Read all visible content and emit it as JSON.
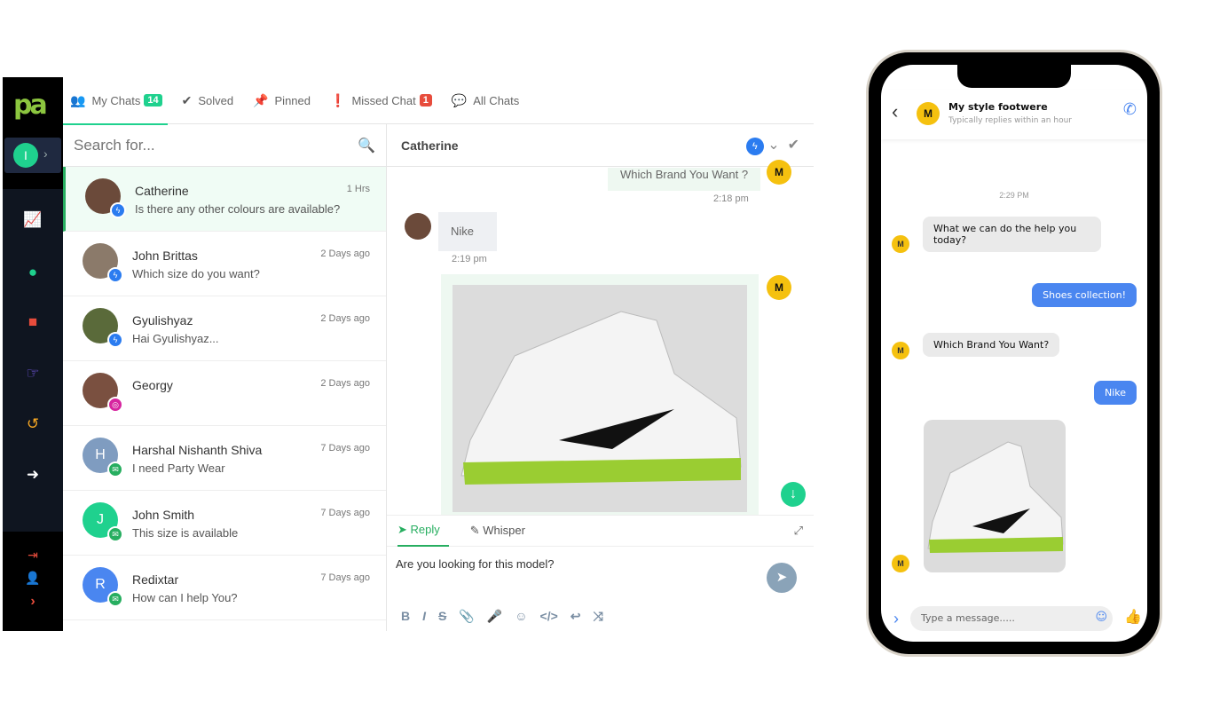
{
  "sidebar": {
    "logo": "pa",
    "user_initial": "I",
    "icons": [
      "analytics-icon",
      "chat-icon",
      "team-icon",
      "pointer-icon",
      "history-icon",
      "arrow-right-circle-icon",
      "logout-icon",
      "user-icon",
      "chevron-right-icon"
    ]
  },
  "tabs": [
    {
      "label": "My Chats",
      "badge": "14",
      "badge_color": "#1fd18e"
    },
    {
      "label": "Solved"
    },
    {
      "label": "Pinned"
    },
    {
      "label": "Missed Chat",
      "badge": "1",
      "badge_color": "#e74c3c"
    },
    {
      "label": "All Chats"
    }
  ],
  "search": {
    "placeholder": "Search for..."
  },
  "chats": [
    {
      "name": "Catherine",
      "message": "Is there any other colours are available?",
      "time": "1 Hrs",
      "channel": "messenger",
      "avatar_color": "#6b4a3a"
    },
    {
      "name": "John Brittas",
      "message": "Which size do you want?",
      "time": "2 Days ago",
      "channel": "messenger",
      "avatar_color": "#8b7a6a"
    },
    {
      "name": "Gyulishyaz",
      "message": "Hai Gyulishyaz...",
      "time": "2 Days ago",
      "channel": "messenger",
      "avatar_color": "#5a6a3a"
    },
    {
      "name": "Georgy",
      "message": "",
      "time": "2 Days ago",
      "channel": "instagram",
      "avatar_color": "#7a5040"
    },
    {
      "name": "Harshal Nishanth Shiva",
      "message": "I need Party Wear",
      "time": "7 Days ago",
      "channel": "webchat",
      "initial": "H",
      "avatar_color": "#7f9cc0"
    },
    {
      "name": "John Smith",
      "message": "This size is available",
      "time": "7 Days ago",
      "channel": "webchat",
      "initial": "J",
      "avatar_color": "#1fd18e"
    },
    {
      "name": "Redixtar",
      "message": "How can I help You?",
      "time": "7 Days ago",
      "channel": "webchat",
      "initial": "R",
      "avatar_color": "#4a86f0"
    }
  ],
  "conversation": {
    "contact": "Catherine",
    "messages": [
      {
        "text": "Which Brand You Want ?",
        "time": "2:18 pm",
        "from": "agent"
      },
      {
        "text": "Nike",
        "time": "2:19 pm",
        "from": "customer"
      }
    ],
    "reply_tabs": [
      "Reply",
      "Whisper"
    ],
    "composer_text": "Are you looking for this model?"
  },
  "phone": {
    "business_name": "My style footwere",
    "status": "Typically replies within an hour",
    "time_label": "2:29 PM",
    "messages": [
      {
        "text": "What we can do the help you today?",
        "from": "business"
      },
      {
        "text": "Shoes collection!",
        "from": "user"
      },
      {
        "text": "Which Brand You Want?",
        "from": "business"
      },
      {
        "text": "Nike",
        "from": "user"
      }
    ],
    "input_placeholder": "Type a message....."
  }
}
